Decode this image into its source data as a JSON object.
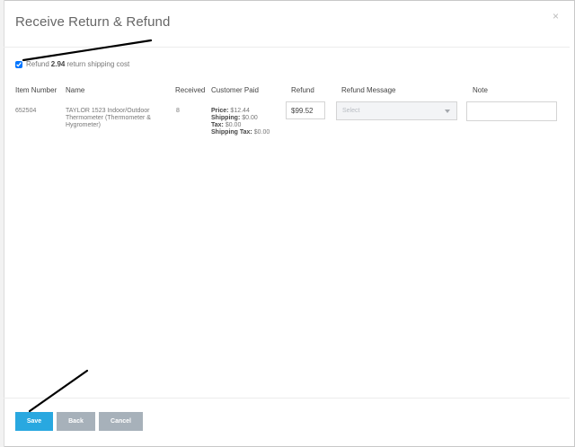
{
  "modal": {
    "title": "Receive Return & Refund",
    "close_glyph": "×"
  },
  "refund_shipping": {
    "checked": true,
    "label_prefix": "Refund",
    "amount": "2.94",
    "label_suffix": "return shipping cost"
  },
  "table": {
    "headers": {
      "item_number": "Item Number",
      "name": "Name",
      "received": "Received",
      "customer_paid": "Customer Paid",
      "refund": "Refund",
      "refund_message": "Refund Message",
      "note": "Note"
    },
    "rows": [
      {
        "item_number": "652504",
        "name": "TAYLOR 1523 Indoor/Outdoor Thermometer (Thermometer & Hygrometer)",
        "received": "8",
        "price_label": "Price:",
        "price": "$12.44",
        "shipping_label": "Shipping:",
        "shipping": "$0.00",
        "tax_label": "Tax:",
        "tax": "$0.00",
        "shipping_tax_label": "Shipping Tax:",
        "shipping_tax": "$0.00",
        "refund_value": "$99.52",
        "refund_message_placeholder": "Select",
        "note_value": ""
      }
    ]
  },
  "footer": {
    "save_label": "Save",
    "back_label": "Back",
    "cancel_label": "Cancel"
  },
  "colors": {
    "primary_button": "#29a8e0",
    "secondary_button": "#a7b1ba",
    "annotation_arrow": "#000000"
  }
}
